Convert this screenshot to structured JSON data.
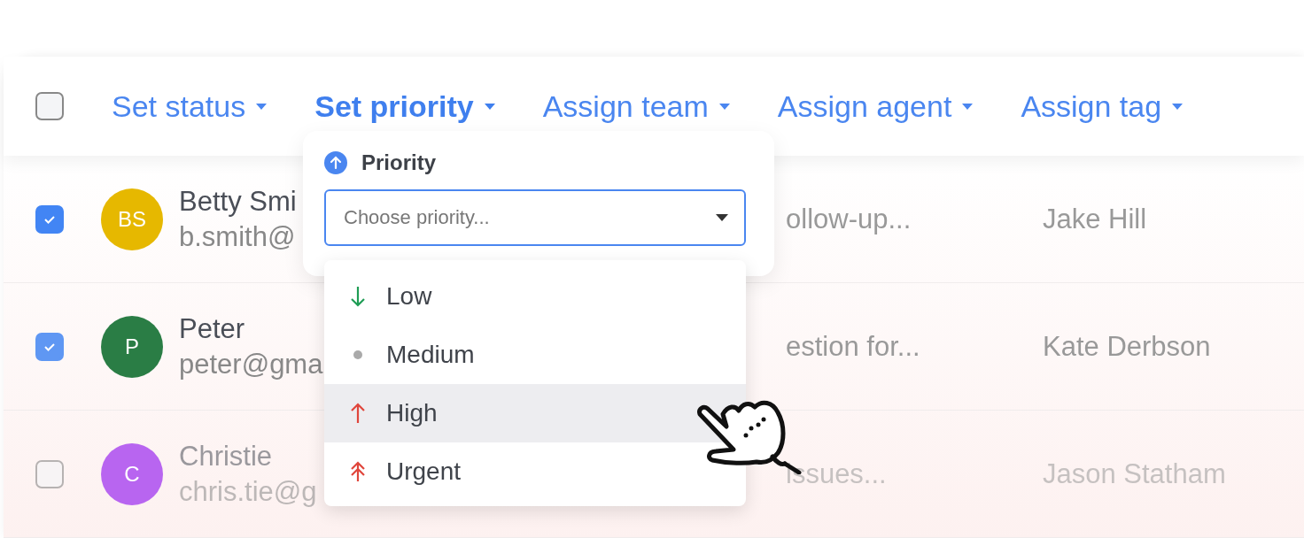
{
  "toolbar": {
    "select_all": {
      "checked": false
    },
    "actions": [
      {
        "label": "Set status",
        "selected": false
      },
      {
        "label": "Set priority",
        "selected": true
      },
      {
        "label": "Assign team",
        "selected": false
      },
      {
        "label": "Assign agent",
        "selected": false
      },
      {
        "label": "Assign tag",
        "selected": false
      }
    ]
  },
  "rows": [
    {
      "checked": true,
      "initials": "BS",
      "color": "#e6b800",
      "name": "Betty Smi",
      "email": "b.smith@",
      "subject": "ollow-up...",
      "agent": "Jake Hill"
    },
    {
      "checked": true,
      "initials": "P",
      "color": "#2a7d45",
      "name": "Peter",
      "email": "peter@gma",
      "subject": "estion for...",
      "agent": "Kate Derbson"
    },
    {
      "checked": false,
      "initials": "C",
      "color": "#b865f0",
      "name": "Christie",
      "email": "chris.tie@g",
      "subject": "issues...",
      "agent": "Jason Statham"
    }
  ],
  "priority_popup": {
    "title": "Priority",
    "field": {
      "placeholder": "Choose priority..."
    },
    "options": [
      {
        "label": "Low",
        "kind": "low",
        "highlighted": false
      },
      {
        "label": "Medium",
        "kind": "medium",
        "highlighted": false
      },
      {
        "label": "High",
        "kind": "high",
        "highlighted": true
      },
      {
        "label": "Urgent",
        "kind": "urgent",
        "highlighted": false
      }
    ]
  }
}
